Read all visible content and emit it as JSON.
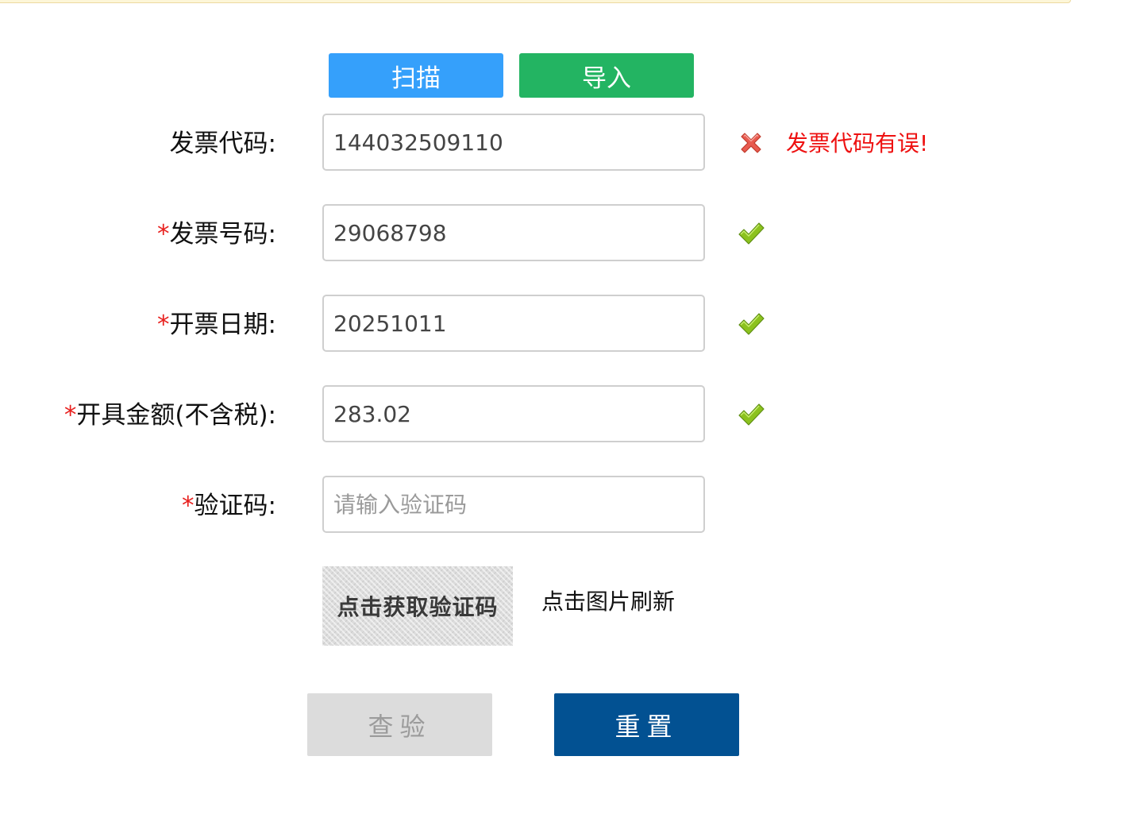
{
  "toolbar": {
    "scan_label": "扫描",
    "import_label": "导入"
  },
  "form": {
    "invoice_code": {
      "label": "发票代码:",
      "required": false,
      "value": "144032509110",
      "status": "error",
      "error_text": "发票代码有误!"
    },
    "invoice_number": {
      "required_mark": "*",
      "label": "发票号码:",
      "value": "29068798",
      "status": "ok"
    },
    "invoice_date": {
      "required_mark": "*",
      "label": "开票日期:",
      "value": "20251011",
      "status": "ok"
    },
    "amount": {
      "required_mark": "*",
      "label": "开具金额(不含税):",
      "value": "283.02",
      "status": "ok"
    },
    "captcha": {
      "required_mark": "*",
      "label": "验证码:",
      "value": "",
      "placeholder": "请输入验证码",
      "image_text": "点击获取验证码",
      "refresh_hint": "点击图片刷新"
    }
  },
  "actions": {
    "check_label": "查验",
    "reset_label": "重置",
    "check_disabled": true
  },
  "colors": {
    "scan_button": "#35a0fb",
    "import_button": "#23b462",
    "reset_button": "#025192",
    "check_button_disabled": "#dcdcdc",
    "error_text": "#ee1111",
    "required_mark": "#e8201e",
    "ok_icon": "#8cc21f",
    "error_icon": "#e85a4f"
  },
  "icons": {
    "error": "red-x-icon",
    "ok": "green-check-icon"
  }
}
